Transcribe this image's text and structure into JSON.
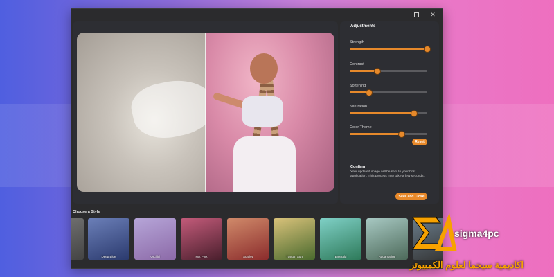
{
  "window": {
    "minimize": "—",
    "maximize": "□",
    "close": "✕"
  },
  "adjustments": {
    "title": "Adjustments",
    "sliders": [
      {
        "label": "Strength",
        "value": 1.0
      },
      {
        "label": "Contrast",
        "value": 0.36
      },
      {
        "label": "Softening",
        "value": 0.25
      },
      {
        "label": "Saturation",
        "value": 0.83
      },
      {
        "label": "Color Theme",
        "value": 0.67
      }
    ],
    "reset_label": "Reset"
  },
  "confirm": {
    "title": "Confirm",
    "text": "Your updated image will be sent to your host application. This process may take a few seconds.",
    "save_label": "Save and Close"
  },
  "styles": {
    "title": "Choose a Style",
    "items": [
      {
        "label": "",
        "colors": [
          "#777",
          "#444"
        ]
      },
      {
        "label": "Deep Blue",
        "colors": [
          "#6b7fb8",
          "#2b3a6e"
        ]
      },
      {
        "label": "Orchid",
        "colors": [
          "#b6a5d8",
          "#8c6aa8"
        ]
      },
      {
        "label": "Hot Pink",
        "colors": [
          "#c35b7a",
          "#4a1f2d"
        ]
      },
      {
        "label": "Scarlet",
        "colors": [
          "#d08a6a",
          "#8b2c2c"
        ]
      },
      {
        "label": "Tuscan Sun",
        "colors": [
          "#d9c27a",
          "#4a6a2e"
        ]
      },
      {
        "label": "Emerald",
        "colors": [
          "#7fd0c6",
          "#2e7a5a"
        ]
      },
      {
        "label": "Aquamarine",
        "colors": [
          "#a7c8c2",
          "#4d6a5a"
        ]
      },
      {
        "label": "",
        "colors": [
          "#6a7c8a",
          "#333"
        ]
      }
    ]
  },
  "watermark": {
    "name": "sigma4pc",
    "arabic": "اكاديمية سيجما لعلوم الكمبيوتر"
  }
}
